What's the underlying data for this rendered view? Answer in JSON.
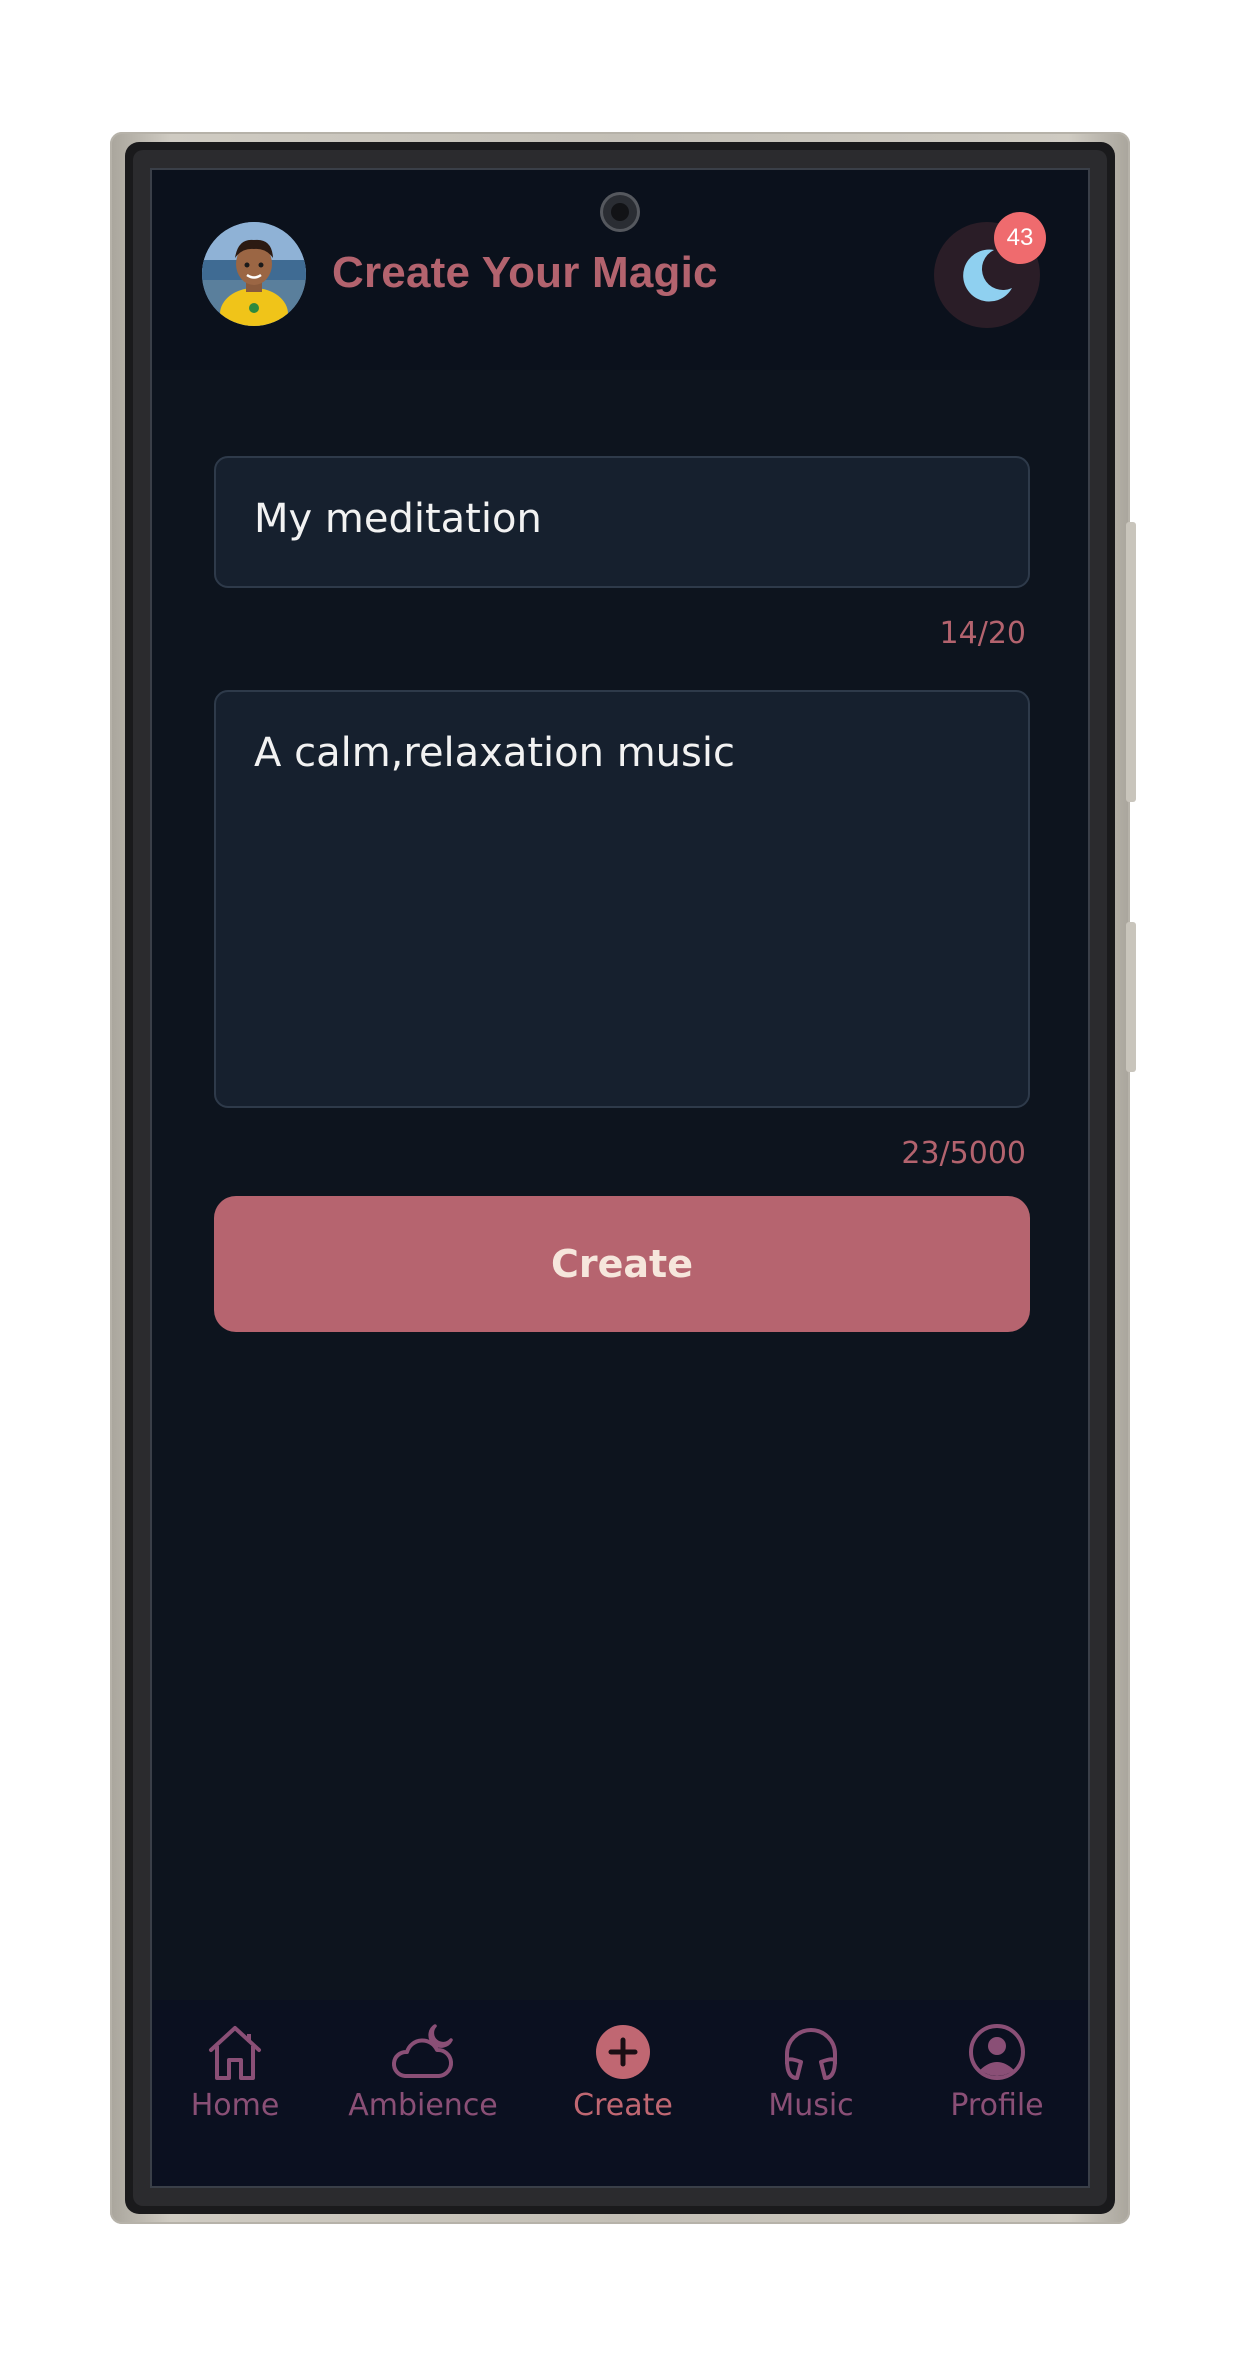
{
  "header": {
    "title": "Create Your Magic",
    "notification_count": "43",
    "avatar_icon": "avatar-boy-icon",
    "theme_icon": "moon-icon"
  },
  "form": {
    "name_value": "My meditation",
    "name_counter": "14/20",
    "prompt_value": "A calm,relaxation music",
    "prompt_counter": "23/5000",
    "create_label": "Create"
  },
  "nav": {
    "items": [
      {
        "label": "Home",
        "icon": "home-icon"
      },
      {
        "label": "Ambience",
        "icon": "cloud-moon-icon"
      },
      {
        "label": "Create",
        "icon": "plus-circle-icon",
        "active": true
      },
      {
        "label": "Music",
        "icon": "headphones-icon"
      },
      {
        "label": "Profile",
        "icon": "user-circle-icon"
      }
    ]
  },
  "colors": {
    "accent": "#b6646f",
    "background": "#0d141e",
    "badge": "#ef6b6e",
    "nav_inactive": "#8a4f76"
  }
}
